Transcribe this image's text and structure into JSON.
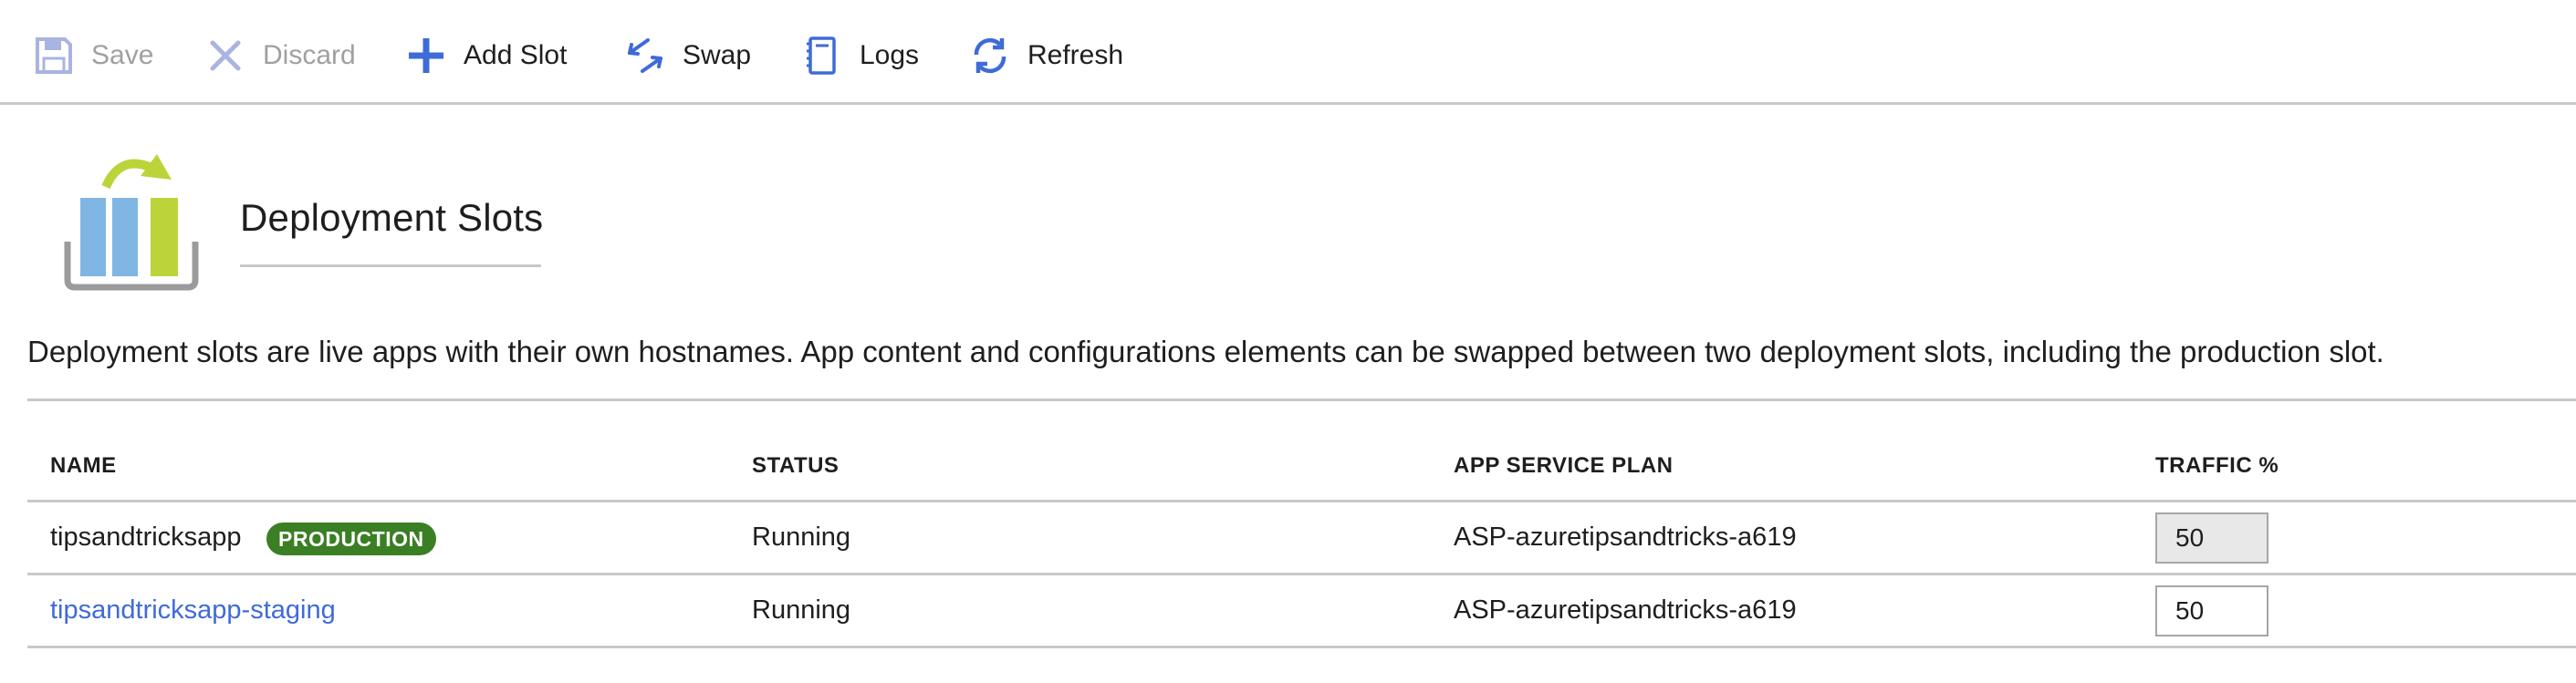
{
  "toolbar": {
    "save_label": "Save",
    "discard_label": "Discard",
    "add_slot_label": "Add Slot",
    "swap_label": "Swap",
    "logs_label": "Logs",
    "refresh_label": "Refresh"
  },
  "header": {
    "title": "Deployment Slots",
    "description": "Deployment slots are live apps with their own hostnames. App content and configurations elements can be swapped between two deployment slots, including the production slot."
  },
  "table": {
    "columns": [
      "NAME",
      "STATUS",
      "APP SERVICE PLAN",
      "TRAFFIC %"
    ],
    "rows": [
      {
        "name": "tipsandtricksapp",
        "badge": "PRODUCTION",
        "status": "Running",
        "plan": "ASP-azuretipsandtricks-a619",
        "traffic": "50"
      },
      {
        "name": "tipsandtricksapp-staging",
        "status": "Running",
        "plan": "ASP-azuretipsandtricks-a619",
        "traffic": "50"
      }
    ]
  },
  "icons": {
    "save": "save-icon",
    "discard": "discard-icon",
    "add": "plus-icon",
    "swap": "swap-icon",
    "logs": "logs-icon",
    "refresh": "refresh-icon",
    "logo": "deployment-slots-logo-icon"
  },
  "colors": {
    "accent": "#3f6bd8",
    "badge": "#3a7f24",
    "disabled": "#a0a0a0",
    "logo_blue": "#7fb6e3",
    "logo_green": "#bcd43a",
    "logo_gray": "#9b9b9b"
  }
}
